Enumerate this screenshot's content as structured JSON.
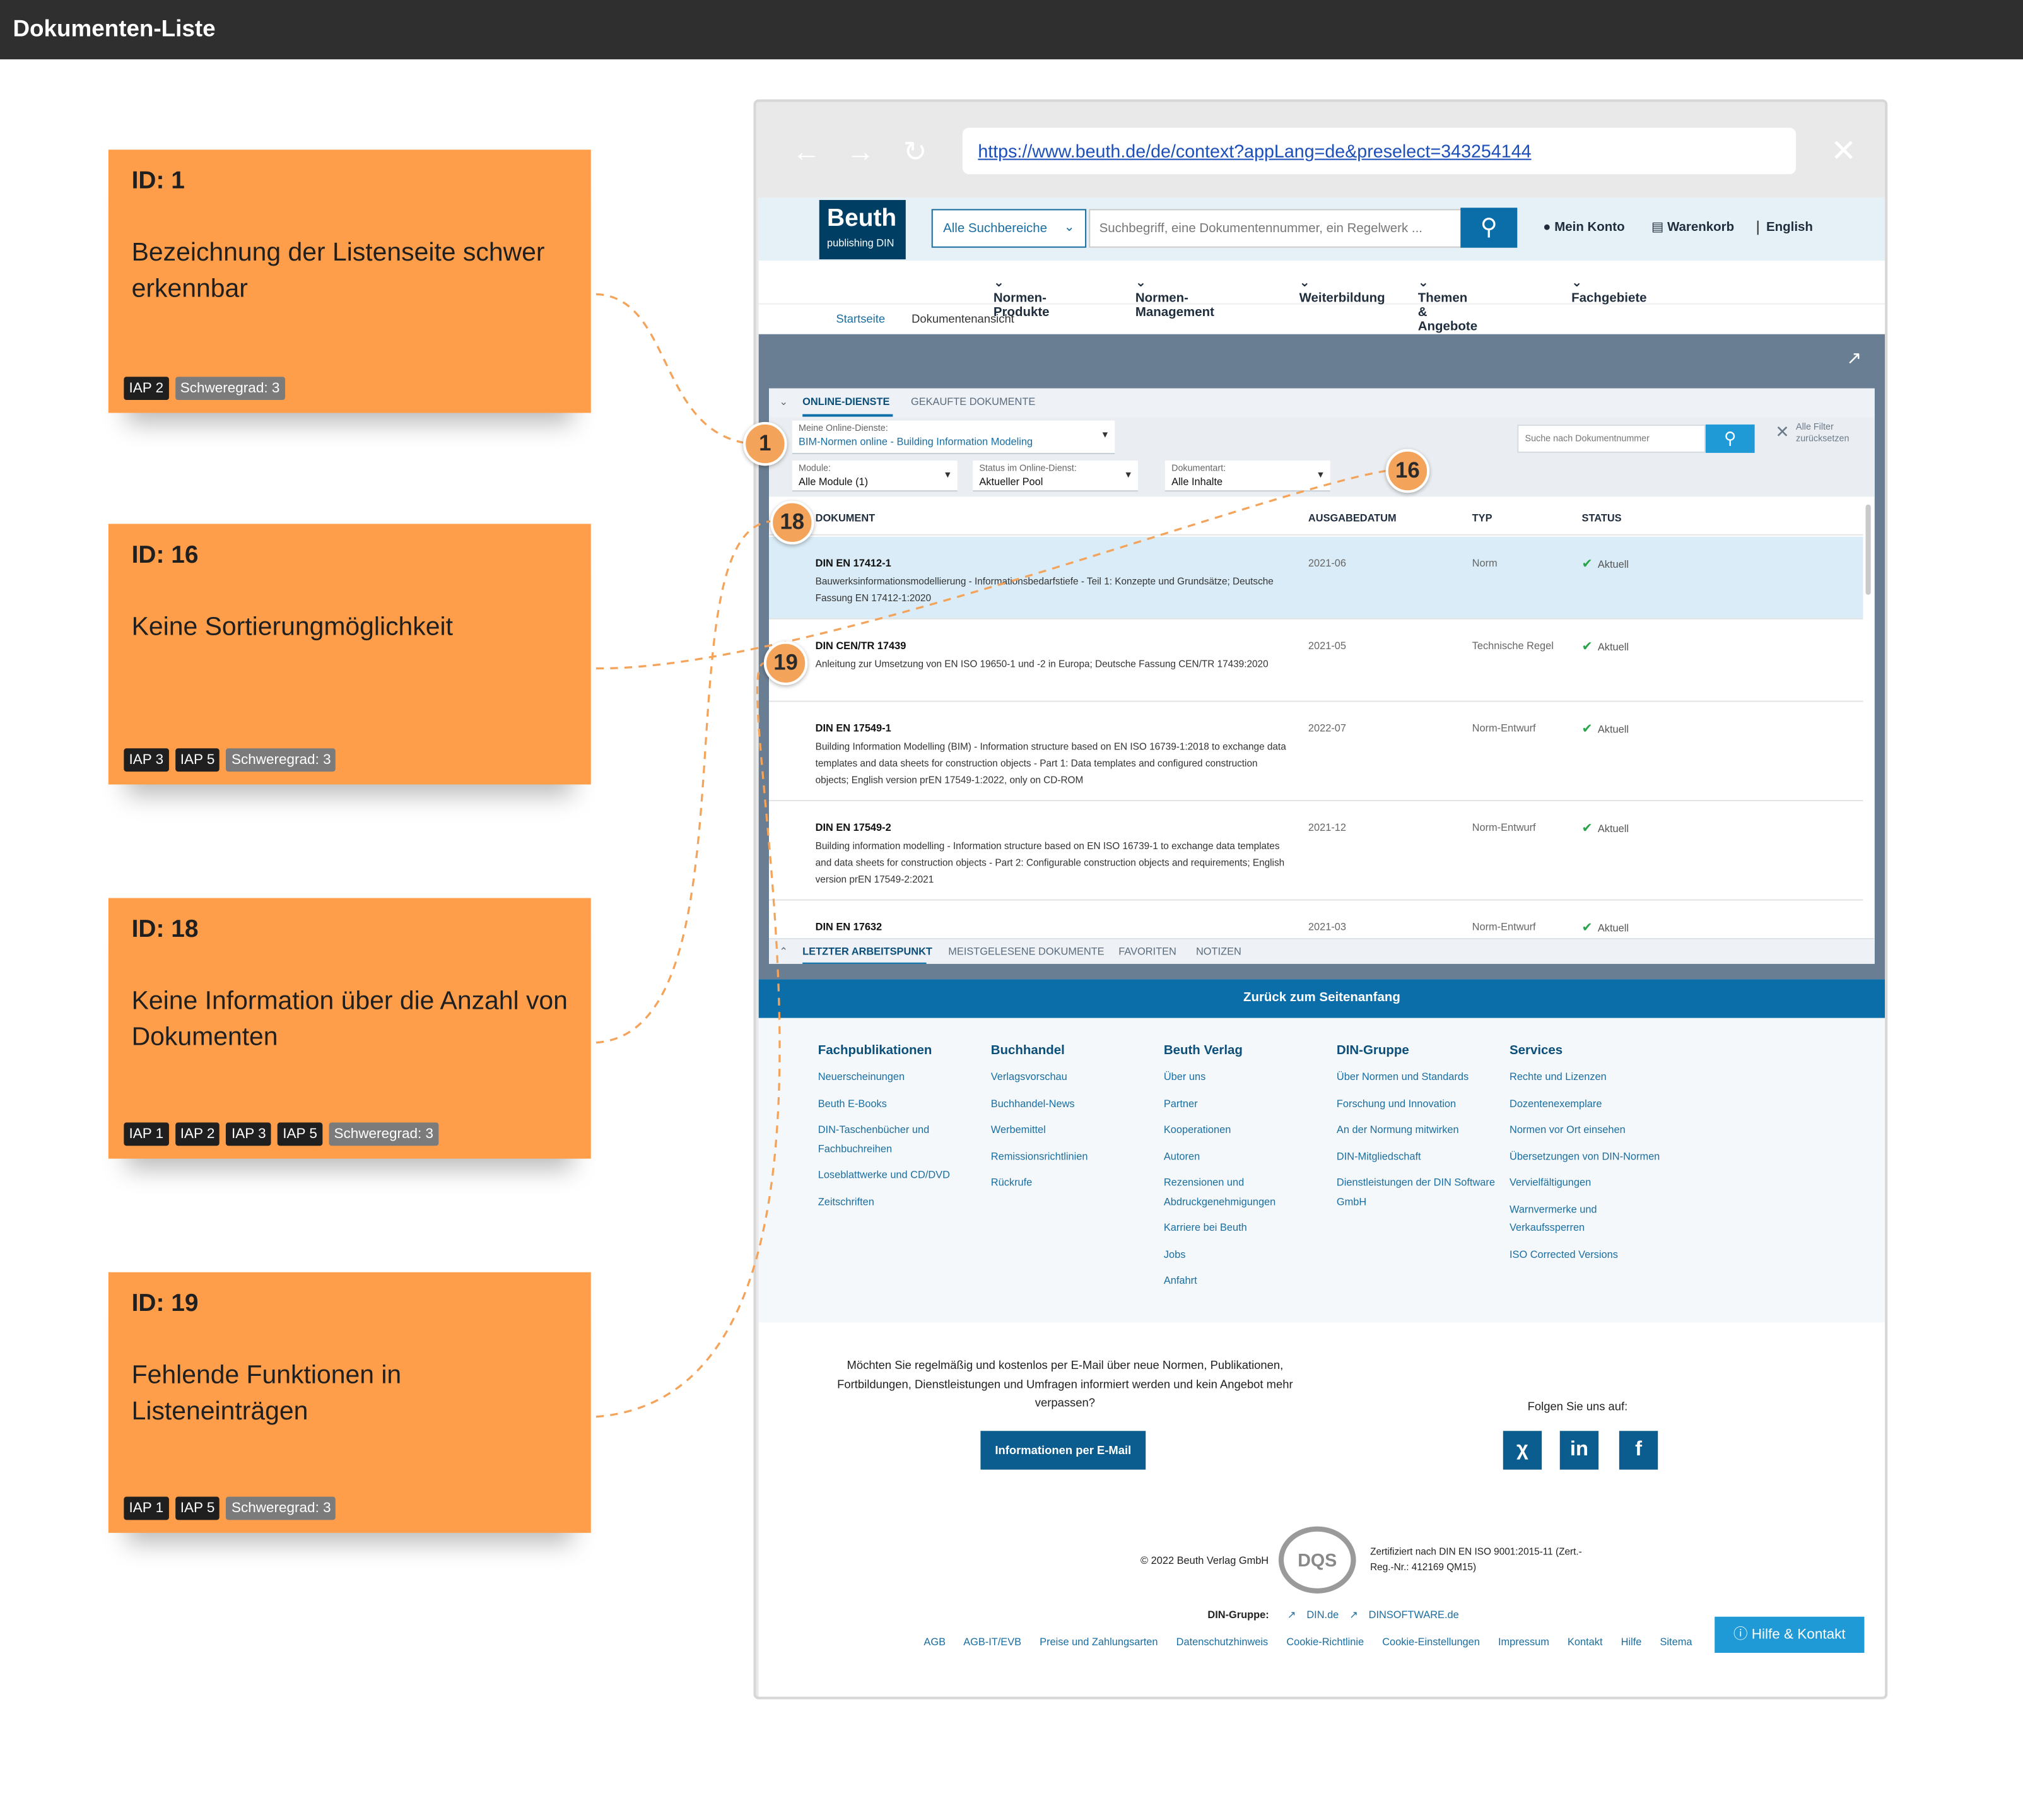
{
  "page_title": "Dokumenten-Liste",
  "notes": [
    {
      "id_label": "ID: 1",
      "text": "Bezeichnung der Listenseite schwer erkennbar",
      "tags": [
        "IAP 2"
      ],
      "severity": "Schweregrad: 3"
    },
    {
      "id_label": "ID: 16",
      "text": "Keine Sortierungmöglichkeit",
      "tags": [
        "IAP 3",
        "IAP 5"
      ],
      "severity": "Schweregrad: 3"
    },
    {
      "id_label": "ID: 18",
      "text": "Keine Information über die Anzahl von Dokumenten",
      "tags": [
        "IAP 1",
        "IAP 2",
        "IAP 3",
        "IAP 5"
      ],
      "severity": "Schweregrad: 3"
    },
    {
      "id_label": "ID: 19",
      "text": "Fehlende Funktionen in Listeneinträgen",
      "tags": [
        "IAP 1",
        "IAP 5"
      ],
      "severity": "Schweregrad: 3"
    }
  ],
  "markers": [
    "1",
    "16",
    "18",
    "19"
  ],
  "browser": {
    "url": "https://www.beuth.de/de/context?appLang=de&preselect=343254144",
    "back_icon": "arrow-left-icon",
    "forward_icon": "arrow-right-icon",
    "reload_icon": "reload-icon",
    "close_icon": "close-icon"
  },
  "site": {
    "logo_main": "Beuth",
    "logo_sub": "publishing DIN",
    "scope": "Alle Suchbereiche",
    "search_placeholder": "Suchbegriff, eine Dokumentennummer, ein Regelwerk ...",
    "account": "Mein Konto",
    "cart": "Warenkorb",
    "language": "English",
    "nav": [
      "Normen-Produkte",
      "Normen-Management",
      "Weiterbildung",
      "Themen & Angebote",
      "Fachgebiete"
    ],
    "breadcrumb": [
      "Startseite",
      "Dokumentenansicht"
    ]
  },
  "panel": {
    "tabs": [
      "ONLINE-DIENSTE",
      "GEKAUFTE DOKUMENTE"
    ],
    "online_service": {
      "label": "Meine Online-Dienste:",
      "value": "BIM-Normen online - Building Information Modeling"
    },
    "filters": [
      {
        "label": "Module:",
        "value": "Alle Module (1)"
      },
      {
        "label": "Status im Online-Dienst:",
        "value": "Aktueller Pool"
      },
      {
        "label": "Dokumentart:",
        "value": "Alle Inhalte"
      }
    ],
    "doc_search_placeholder": "Suche nach Dokumentnummer",
    "reset_filters": "Alle Filter zurücksetzen",
    "columns": [
      "DOKUMENT",
      "AUSGABEDATUM",
      "TYP",
      "STATUS"
    ],
    "rows": [
      {
        "number": "DIN EN 17412-1",
        "title": "Bauwerksinformationsmodellierung - Informationsbedarfstiefe - Teil 1: Konzepte und Grundsätze; Deutsche Fassung EN 17412-1:2020",
        "date": "2021-06",
        "type": "Norm",
        "status": "Aktuell"
      },
      {
        "number": "DIN CEN/TR 17439",
        "title": "Anleitung zur Umsetzung von EN ISO 19650-1 und -2 in Europa; Deutsche Fassung CEN/TR 17439:2020",
        "date": "2021-05",
        "type": "Technische Regel",
        "status": "Aktuell"
      },
      {
        "number": "DIN EN 17549-1",
        "title": "Building Information Modelling (BIM) - Information structure based on EN ISO 16739-1:2018 to exchange data templates and data sheets for construction objects - Part 1: Data templates and configured construction objects; English version prEN 17549-1:2022, only on CD-ROM",
        "date": "2022-07",
        "type": "Norm-Entwurf",
        "status": "Aktuell"
      },
      {
        "number": "DIN EN 17549-2",
        "title": "Building information modelling - Information structure based on EN ISO 16739-1 to exchange data templates and data sheets for construction objects - Part 2: Configurable construction objects and requirements; English version prEN 17549-2:2021",
        "date": "2021-12",
        "type": "Norm-Entwurf",
        "status": "Aktuell"
      },
      {
        "number": "DIN EN 17632",
        "title": "",
        "date": "2021-03",
        "type": "Norm-Entwurf",
        "status": "Aktuell"
      }
    ],
    "bottom_tabs": [
      "LETZTER ARBEITSPUNKT",
      "MEISTGELESENE DOKUMENTE",
      "FAVORITEN",
      "NOTIZEN"
    ]
  },
  "back_to_top": "Zurück zum Seitenanfang",
  "footer": {
    "columns": [
      {
        "title": "Fachpublikationen",
        "links": [
          "Neuerscheinungen",
          "Beuth E-Books",
          "DIN-Taschenbücher und Fachbuchreihen",
          "Loseblattwerke und CD/DVD",
          "Zeitschriften"
        ]
      },
      {
        "title": "Buchhandel",
        "links": [
          "Verlagsvorschau",
          "Buchhandel-News",
          "Werbemittel",
          "Remissionsrichtlinien",
          "Rückrufe"
        ]
      },
      {
        "title": "Beuth Verlag",
        "links": [
          "Über uns",
          "Partner",
          "Kooperationen",
          "Autoren",
          "Rezensionen und Abdruckgenehmigungen",
          "Karriere bei Beuth",
          "Jobs",
          "Anfahrt"
        ]
      },
      {
        "title": "DIN-Gruppe",
        "links": [
          "Über Normen und Standards",
          "Forschung und Innovation",
          "An der Normung mitwirken",
          "DIN-Mitgliedschaft",
          "Dienstleistungen der DIN Software GmbH"
        ]
      },
      {
        "title": "Services",
        "links": [
          "Rechte und Lizenzen",
          "Dozentenexemplare",
          "Normen vor Ort einsehen",
          "Übersetzungen von DIN-Normen",
          "Vervielfältigungen",
          "Warnvermerke und Verkaufssperren",
          "ISO Corrected Versions"
        ]
      }
    ],
    "newsletter_text": "Möchten Sie regelmäßig und kostenlos per E-Mail über neue Normen, Publikationen, Fortbildungen, Dienstleistungen und Umfragen informiert werden und kein Angebot mehr verpassen?",
    "newsletter_button": "Informationen per E-Mail",
    "follow": "Folgen Sie uns auf:",
    "social": [
      "xing-icon",
      "linkedin-icon",
      "facebook-icon"
    ],
    "copyright": "© 2022 Beuth Verlag GmbH",
    "cert": "Zertifiziert nach DIN EN ISO 9001:2015-11 (Zert.-Reg.-Nr.: 412169 QM15)",
    "din_group_label": "DIN-Gruppe:",
    "din_links": [
      "DIN.de",
      "DINSOFTWARE.de"
    ],
    "legal": [
      "AGB",
      "AGB-IT/EVB",
      "Preise und Zahlungsarten",
      "Datenschutzhinweis",
      "Cookie-Richtlinie",
      "Cookie-Einstellungen",
      "Impressum",
      "Kontakt",
      "Hilfe",
      "Sitema"
    ],
    "help": "Hilfe & Kontakt"
  },
  "colors": {
    "note": "#ff9e4a",
    "accent": "#0b6ea8",
    "marker": "#f4a35a",
    "connector": "#f4a35a"
  }
}
